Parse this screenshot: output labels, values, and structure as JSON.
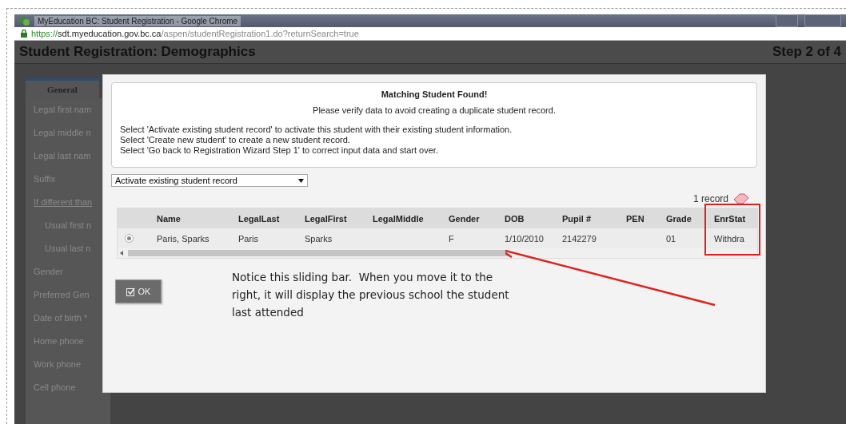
{
  "window": {
    "title": "MyEducation BC: Student Registration - Google Chrome"
  },
  "address_bar": {
    "scheme": "https://",
    "host": "sdt.myeducation.gov.bc.ca",
    "path": "/aspen/studentRegistration1.do?returnSearch=true"
  },
  "header": {
    "title": "Student Registration: Demographics",
    "step": "Step 2 of 4"
  },
  "tabs": [
    {
      "label": "General",
      "selected": true
    }
  ],
  "form_fields": [
    {
      "label": "Legal first nam"
    },
    {
      "label": "Legal middle n"
    },
    {
      "label": "Legal last nam"
    },
    {
      "label": "Suffix"
    },
    {
      "label": "If different than",
      "children": [
        {
          "label": "Usual first n"
        },
        {
          "label": "Usual last n"
        }
      ]
    },
    {
      "label": "Gender"
    },
    {
      "label": "Preferred Gen"
    },
    {
      "label": "Date of birth *"
    },
    {
      "label": "Home phone"
    },
    {
      "label": "Work phone"
    },
    {
      "label": "Cell phone"
    }
  ],
  "dialog": {
    "title": "Matching Student Found!",
    "subtitle": "Please verify data to avoid creating a duplicate student record.",
    "instructions": [
      "Select 'Activate existing student record' to activate this student with their existing student information.",
      "Select 'Create new student' to create a new student record.",
      "Select 'Go back to Registration Wizard Step 1' to correct input data and start over."
    ],
    "action_select": {
      "value": "Activate existing student record"
    },
    "record_count": "1 record",
    "table": {
      "columns": [
        "Name",
        "LegalLast",
        "LegalFirst",
        "LegalMiddle",
        "Gender",
        "DOB",
        "Pupil #",
        "PEN",
        "Grade",
        "EnrStat"
      ],
      "rows": [
        {
          "selected": true,
          "cells": [
            "Paris, Sparks",
            "Paris",
            "Sparks",
            "",
            "F",
            "1/10/2010",
            "2142279",
            "",
            "01",
            "Withdra"
          ]
        }
      ]
    },
    "ok_button": "OK"
  },
  "annotation": {
    "text": "Notice this sliding bar.  When you move it to the right, it will display the previous school the student last attended"
  }
}
